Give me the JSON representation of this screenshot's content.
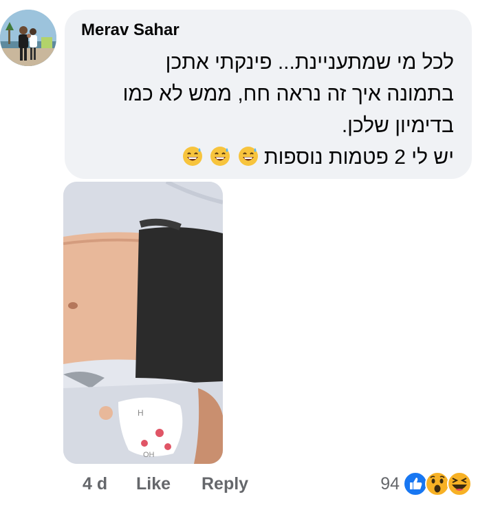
{
  "comment": {
    "author": "Merav Sahar",
    "lines": [
      "לכל מי שמתעניינת... פינקתי אתכן",
      "בתמונה איך זה נראה חח, ממש לא כמו",
      "בדימיון שלכן.",
      "יש לי 2 פטמות נוספות"
    ],
    "emoji_icons": [
      "grinning-sweat-icon",
      "grinning-sweat-icon",
      "grinning-sweat-icon"
    ]
  },
  "actions": {
    "time": "4 d",
    "like": "Like",
    "reply": "Reply"
  },
  "reactions": {
    "count": "94",
    "icons": [
      "like-icon",
      "wow-icon",
      "haha-icon"
    ],
    "colors": {
      "like": "#1877f2",
      "emoji": "#f7b125"
    }
  }
}
